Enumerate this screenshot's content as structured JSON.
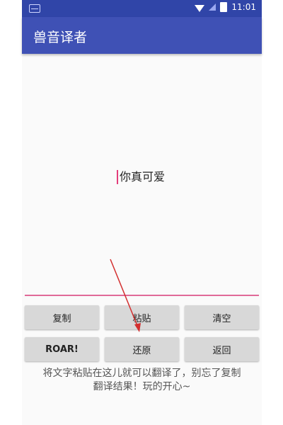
{
  "status_bar": {
    "time": "11:01",
    "wifi_icon": "wifi-icon",
    "signal_icon": "signal-icon",
    "battery_icon": "battery-icon"
  },
  "app_bar": {
    "title": "兽音译者"
  },
  "editor": {
    "text": "你真可爱"
  },
  "buttons": {
    "copy": "复制",
    "paste": "粘贴",
    "clear": "清空",
    "roar": "ROAR!",
    "restore": "还原",
    "back": "返回"
  },
  "hint": {
    "line1": "将文字粘贴在这儿就可以翻译了，别忘了复制",
    "line2": "翻译结果！玩的开心~"
  },
  "colors": {
    "app_bar": "#3f51b5",
    "status_bar": "#3045a8",
    "accent": "#e06a98",
    "annotation_arrow": "#d32f2f"
  }
}
